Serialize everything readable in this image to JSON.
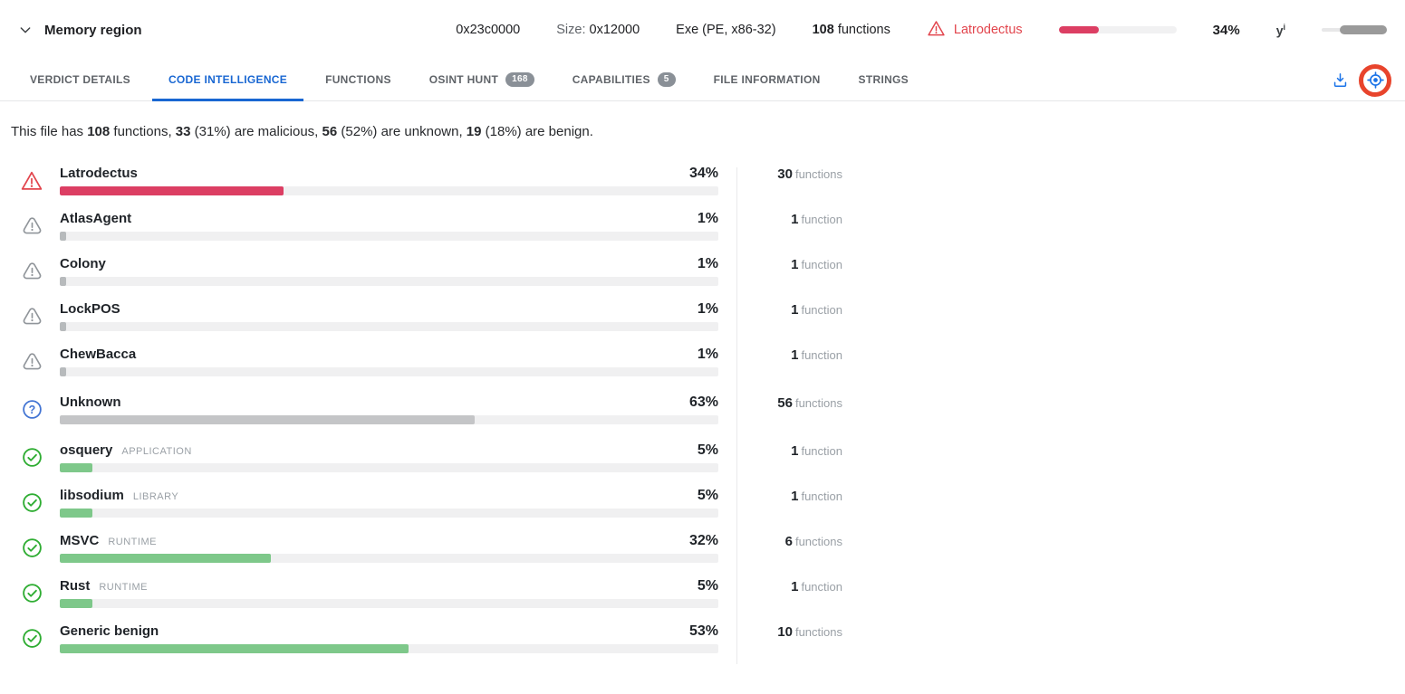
{
  "header": {
    "title": "Memory region",
    "address": "0x23c0000",
    "size_label": "Size:",
    "size_value": "0x12000",
    "file_type": "Exe (PE, x86-32)",
    "functions_count": "108",
    "functions_label": "functions",
    "threat_name": "Latrodectus",
    "threat_percent": 34,
    "threat_percent_label": "34%",
    "slider_label_base": "y",
    "slider_label_sup": "i"
  },
  "tabs": [
    {
      "label": "VERDICT DETAILS",
      "active": false
    },
    {
      "label": "CODE INTELLIGENCE",
      "active": true
    },
    {
      "label": "FUNCTIONS",
      "active": false
    },
    {
      "label": "OSINT HUNT",
      "active": false,
      "badge": "168"
    },
    {
      "label": "CAPABILITIES",
      "active": false,
      "badge": "5"
    },
    {
      "label": "FILE INFORMATION",
      "active": false
    },
    {
      "label": "STRINGS",
      "active": false
    }
  ],
  "summary": {
    "segments": [
      {
        "text": "This file has ",
        "bold": false
      },
      {
        "text": "108",
        "bold": true
      },
      {
        "text": " functions, ",
        "bold": false
      },
      {
        "text": "33",
        "bold": true
      },
      {
        "text": " (31%) are malicious, ",
        "bold": false
      },
      {
        "text": "56",
        "bold": true
      },
      {
        "text": " (52%) are unknown, ",
        "bold": false
      },
      {
        "text": "19",
        "bold": true
      },
      {
        "text": " (18%) are benign.",
        "bold": false
      }
    ]
  },
  "rows": [
    {
      "name": "Latrodectus",
      "tag": "",
      "icon": "warning",
      "percent": 34,
      "percent_label": "34%",
      "count": "30",
      "count_unit": "functions",
      "bar_color": "#dc3e63",
      "group_gap": false
    },
    {
      "name": "AtlasAgent",
      "tag": "",
      "icon": "alert",
      "percent": 1,
      "percent_label": "1%",
      "count": "1",
      "count_unit": "function",
      "bar_color": "#b7babc",
      "group_gap": false
    },
    {
      "name": "Colony",
      "tag": "",
      "icon": "alert",
      "percent": 1,
      "percent_label": "1%",
      "count": "1",
      "count_unit": "function",
      "bar_color": "#b7babc",
      "group_gap": false
    },
    {
      "name": "LockPOS",
      "tag": "",
      "icon": "alert",
      "percent": 1,
      "percent_label": "1%",
      "count": "1",
      "count_unit": "function",
      "bar_color": "#b7babc",
      "group_gap": false
    },
    {
      "name": "ChewBacca",
      "tag": "",
      "icon": "alert",
      "percent": 1,
      "percent_label": "1%",
      "count": "1",
      "count_unit": "function",
      "bar_color": "#b7babc",
      "group_gap": false
    },
    {
      "name": "Unknown",
      "tag": "",
      "icon": "question",
      "percent": 63,
      "percent_label": "63%",
      "count": "56",
      "count_unit": "functions",
      "bar_color": "#c4c5c7",
      "group_gap": true
    },
    {
      "name": "osquery",
      "tag": "APPLICATION",
      "icon": "check",
      "percent": 5,
      "percent_label": "5%",
      "count": "1",
      "count_unit": "function",
      "bar_color": "#7ec88a",
      "group_gap": true
    },
    {
      "name": "libsodium",
      "tag": "LIBRARY",
      "icon": "check",
      "percent": 5,
      "percent_label": "5%",
      "count": "1",
      "count_unit": "function",
      "bar_color": "#7ec88a",
      "group_gap": false
    },
    {
      "name": "MSVC",
      "tag": "RUNTIME",
      "icon": "check",
      "percent": 32,
      "percent_label": "32%",
      "count": "6",
      "count_unit": "functions",
      "bar_color": "#7ec88a",
      "group_gap": false
    },
    {
      "name": "Rust",
      "tag": "RUNTIME",
      "icon": "check",
      "percent": 5,
      "percent_label": "5%",
      "count": "1",
      "count_unit": "function",
      "bar_color": "#7ec88a",
      "group_gap": false
    },
    {
      "name": "Generic benign",
      "tag": "",
      "icon": "check",
      "percent": 53,
      "percent_label": "53%",
      "count": "10",
      "count_unit": "functions",
      "bar_color": "#7ec88a",
      "group_gap": false
    }
  ],
  "colors": {
    "red": "#e2454d",
    "gray": "#90959a",
    "blue_question": "#4274d3",
    "green": "#2fad33",
    "accent_blue": "#1a73e8",
    "annotation_ring": "#e8442c",
    "bar_red": "#dc3e63"
  }
}
